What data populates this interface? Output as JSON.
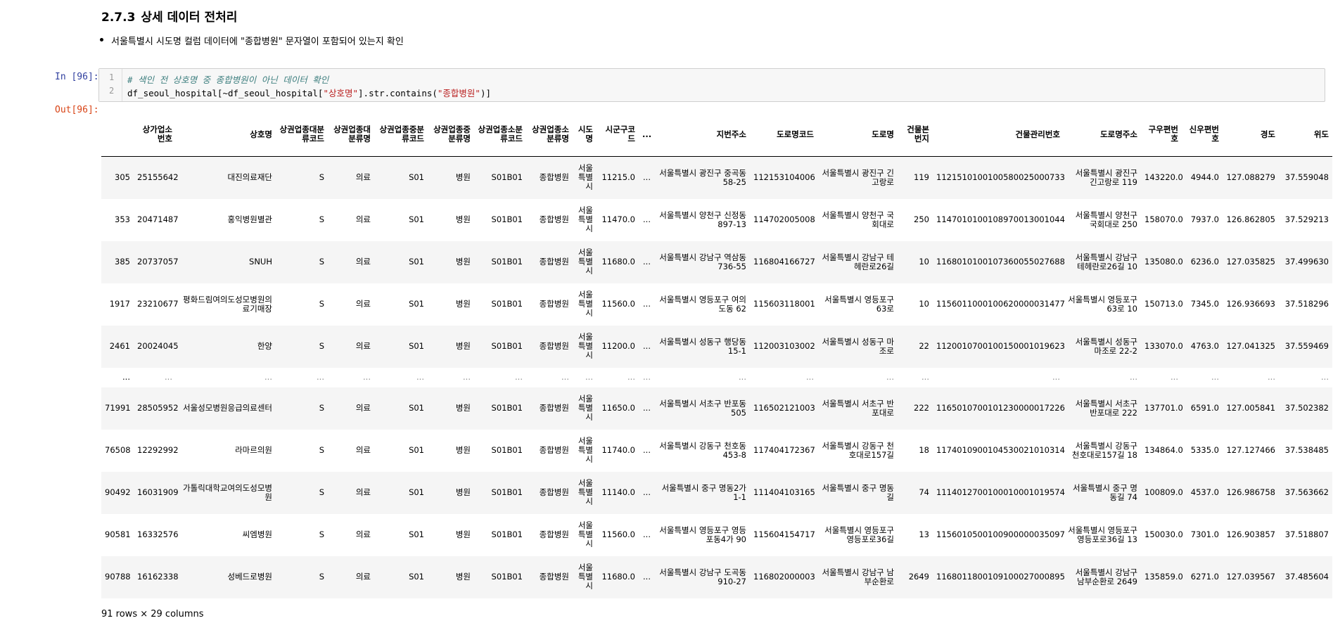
{
  "section": {
    "number": "2.7.3",
    "title": "상세 데이터 전처리"
  },
  "bullet": "서울특별시 시도명 컬럼 데이터에 \"종합병원\" 문자열이 포함되어 있는지 확인",
  "cell": {
    "in_prompt": "In [96]:",
    "out_prompt": "Out[96]:",
    "line_numbers": [
      "1",
      "2"
    ],
    "line1": "# 색인 전 상호명 중 종합병원이 아닌 데이터 확인",
    "line2_prefix": "df_seoul_hospital[~df_seoul_hospital[",
    "line2_str1": "\"상호명\"",
    "line2_mid": "].str.contains(",
    "line2_str2": "\"종합병원\"",
    "line2_suffix": ")]"
  },
  "table": {
    "columns": [
      "",
      "상가업소번호",
      "상호명",
      "상권업종대분류코드",
      "상권업종대분류명",
      "상권업종중분류코드",
      "상권업종중분류명",
      "상권업종소분류코드",
      "상권업종소분류명",
      "시도명",
      "시군구코드",
      "...",
      "지번주소",
      "도로명코드",
      "도로명",
      "건물본번지",
      "건물관리번호",
      "도로명주소",
      "구우편번호",
      "신우편번호",
      "경도",
      "위도"
    ],
    "rows": [
      [
        "305",
        "25155642",
        "대진의료재단",
        "S",
        "의료",
        "S01",
        "병원",
        "S01B01",
        "종합병원",
        "서울특별시",
        "11215.0",
        "...",
        "서울특별시 광진구 중곡동 58-25",
        "112153104006",
        "서울특별시 광진구 긴고랑로",
        "119",
        "1121510100100580025000733",
        "서울특별시 광진구 긴고랑로 119",
        "143220.0",
        "4944.0",
        "127.088279",
        "37.559048"
      ],
      [
        "353",
        "20471487",
        "홍익병원별관",
        "S",
        "의료",
        "S01",
        "병원",
        "S01B01",
        "종합병원",
        "서울특별시",
        "11470.0",
        "...",
        "서울특별시 양천구 신정동 897-13",
        "114702005008",
        "서울특별시 양천구 국회대로",
        "250",
        "1147010100108970013001044",
        "서울특별시 양천구 국회대로 250",
        "158070.0",
        "7937.0",
        "126.862805",
        "37.529213"
      ],
      [
        "385",
        "20737057",
        "SNUH",
        "S",
        "의료",
        "S01",
        "병원",
        "S01B01",
        "종합병원",
        "서울특별시",
        "11680.0",
        "...",
        "서울특별시 강남구 역삼동 736-55",
        "116804166727",
        "서울특별시 강남구 테헤란로26길",
        "10",
        "1168010100107360055027688",
        "서울특별시 강남구 테헤란로26길 10",
        "135080.0",
        "6236.0",
        "127.035825",
        "37.499630"
      ],
      [
        "1917",
        "23210677",
        "평화드림여의도성모병원의료기매장",
        "S",
        "의료",
        "S01",
        "병원",
        "S01B01",
        "종합병원",
        "서울특별시",
        "11560.0",
        "...",
        "서울특별시 영등포구 여의도동 62",
        "115603118001",
        "서울특별시 영등포구 63로",
        "10",
        "1156011000100620000031477",
        "서울특별시 영등포구 63로 10",
        "150713.0",
        "7345.0",
        "126.936693",
        "37.518296"
      ],
      [
        "2461",
        "20024045",
        "한양",
        "S",
        "의료",
        "S01",
        "병원",
        "S01B01",
        "종합병원",
        "서울특별시",
        "11200.0",
        "...",
        "서울특별시 성동구 행당동 15-1",
        "112003103002",
        "서울특별시 성동구 마조로",
        "22",
        "1120010700100150001019623",
        "서울특별시 성동구 마조로 22-2",
        "133070.0",
        "4763.0",
        "127.041325",
        "37.559469"
      ],
      [
        "...",
        "...",
        "...",
        "...",
        "...",
        "...",
        "...",
        "...",
        "...",
        "...",
        "...",
        "...",
        "...",
        "...",
        "...",
        "...",
        "...",
        "...",
        "...",
        "...",
        "...",
        "..."
      ],
      [
        "71991",
        "28505952",
        "서울성모병원응급의료센터",
        "S",
        "의료",
        "S01",
        "병원",
        "S01B01",
        "종합병원",
        "서울특별시",
        "11650.0",
        "...",
        "서울특별시 서초구 반포동 505",
        "116502121003",
        "서울특별시 서초구 반포대로",
        "222",
        "1165010700101230000017226",
        "서울특별시 서초구 반포대로 222",
        "137701.0",
        "6591.0",
        "127.005841",
        "37.502382"
      ],
      [
        "76508",
        "12292992",
        "라마르의원",
        "S",
        "의료",
        "S01",
        "병원",
        "S01B01",
        "종합병원",
        "서울특별시",
        "11740.0",
        "...",
        "서울특별시 강동구 천호동 453-8",
        "117404172367",
        "서울특별시 강동구 천호대로157길",
        "18",
        "1174010900104530021010314",
        "서울특별시 강동구 천호대로157길 18",
        "134864.0",
        "5335.0",
        "127.127466",
        "37.538485"
      ],
      [
        "90492",
        "16031909",
        "가톨릭대학교여의도성모병원",
        "S",
        "의료",
        "S01",
        "병원",
        "S01B01",
        "종합병원",
        "서울특별시",
        "11140.0",
        "...",
        "서울특별시 중구 명동2가 1-1",
        "111404103165",
        "서울특별시 중구 명동길",
        "74",
        "1114012700100010001019574",
        "서울특별시 중구 명동길 74",
        "100809.0",
        "4537.0",
        "126.986758",
        "37.563662"
      ],
      [
        "90581",
        "16332576",
        "씨엠병원",
        "S",
        "의료",
        "S01",
        "병원",
        "S01B01",
        "종합병원",
        "서울특별시",
        "11560.0",
        "...",
        "서울특별시 영등포구 영등포동4가 90",
        "115604154717",
        "서울특별시 영등포구 영등포로36길",
        "13",
        "1156010500100900000035097",
        "서울특별시 영등포구 영등포로36길 13",
        "150030.0",
        "7301.0",
        "126.903857",
        "37.518807"
      ],
      [
        "90788",
        "16162338",
        "성베드로병원",
        "S",
        "의료",
        "S01",
        "병원",
        "S01B01",
        "종합병원",
        "서울특별시",
        "11680.0",
        "...",
        "서울특별시 강남구 도곡동 910-27",
        "116802000003",
        "서울특별시 강남구 남부순환로",
        "2649",
        "1168011800109100027000895",
        "서울특별시 강남구 남부순환로 2649",
        "135859.0",
        "6271.0",
        "127.039567",
        "37.485604"
      ]
    ],
    "footer": "91 rows × 29 columns"
  }
}
